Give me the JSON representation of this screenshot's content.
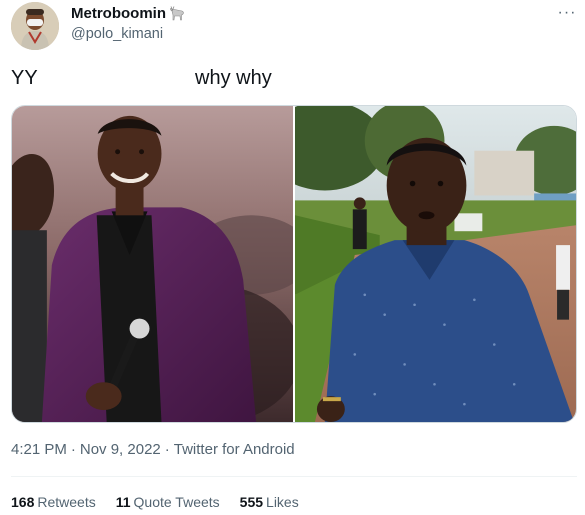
{
  "author": {
    "display_name": "Metroboomin",
    "name_emoji": "goat-emoji",
    "handle": "@polo_kimani"
  },
  "tweet": {
    "text_left": "YY",
    "text_right": "why why"
  },
  "media": {
    "images": [
      {
        "icon": "photo-man-purple-suit-microphone"
      },
      {
        "icon": "photo-man-blue-shirt-outdoors"
      }
    ]
  },
  "meta": {
    "time": "4:21 PM",
    "date": "Nov 9, 2022",
    "source": "Twitter for Android",
    "separator": "·"
  },
  "stats": {
    "retweets_count": "168",
    "retweets_label": "Retweets",
    "quotes_count": "11",
    "quotes_label": "Quote Tweets",
    "likes_count": "555",
    "likes_label": "Likes"
  },
  "colors": {
    "text_primary": "#0f1419",
    "text_secondary": "#536471",
    "border": "#cfd9de",
    "divider": "#eff3f4"
  }
}
